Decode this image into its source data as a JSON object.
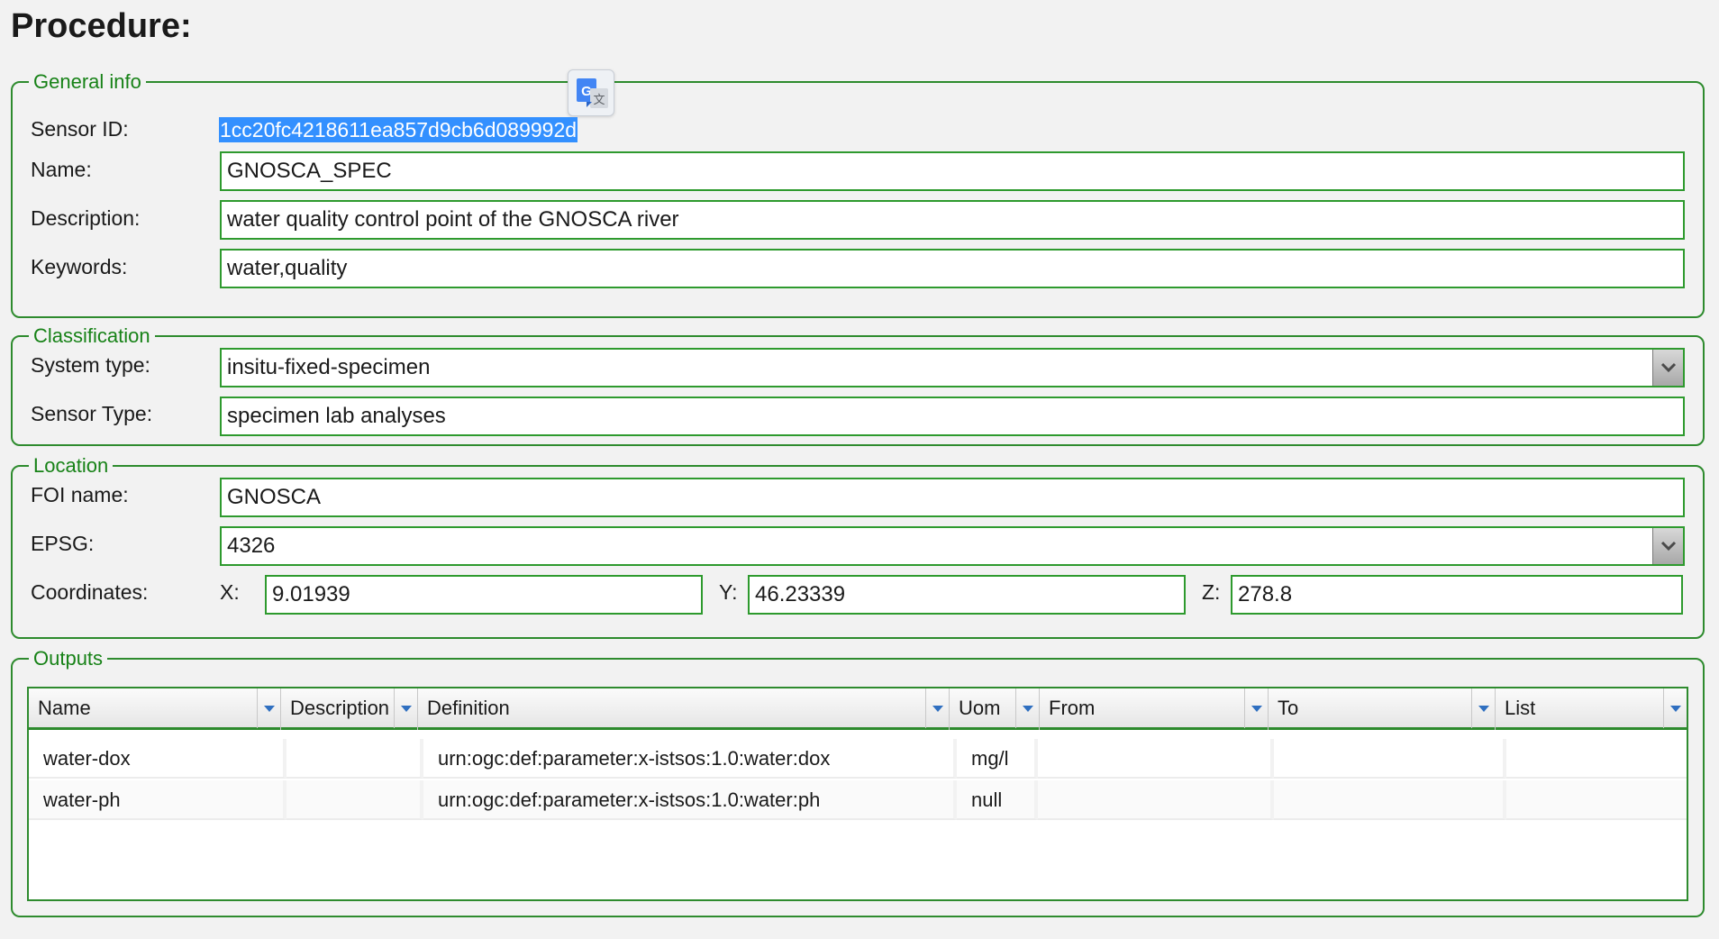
{
  "page": {
    "title": "Procedure:"
  },
  "general_info": {
    "legend": "General info",
    "sensor_id_label": "Sensor ID:",
    "sensor_id_value": "1cc20fc4218611ea857d9cb6d089992d",
    "name_label": "Name:",
    "name_value": "GNOSCA_SPEC",
    "description_label": "Description:",
    "description_value": "water quality control point of the GNOSCA river",
    "keywords_label": "Keywords:",
    "keywords_value": "water,quality"
  },
  "classification": {
    "legend": "Classification",
    "system_type_label": "System type:",
    "system_type_value": "insitu-fixed-specimen",
    "sensor_type_label": "Sensor Type:",
    "sensor_type_value": "specimen lab analyses"
  },
  "location": {
    "legend": "Location",
    "foi_label": "FOI name:",
    "foi_value": "GNOSCA",
    "epsg_label": "EPSG:",
    "epsg_value": "4326",
    "coordinates_label": "Coordinates:",
    "x_label": "X:",
    "x_value": "9.01939",
    "y_label": "Y:",
    "y_value": "46.23339",
    "z_label": "Z:",
    "z_value": "278.8"
  },
  "outputs": {
    "legend": "Outputs",
    "columns": [
      "Name",
      "Description",
      "Definition",
      "Uom",
      "From",
      "To",
      "List"
    ],
    "rows": [
      {
        "name": "water-dox",
        "description": "",
        "definition": "urn:ogc:def:parameter:x-istsos:1.0:water:dox",
        "uom": "mg/l",
        "from": "",
        "to": "",
        "list": ""
      },
      {
        "name": "water-ph",
        "description": "",
        "definition": "urn:ogc:def:parameter:x-istsos:1.0:water:ph",
        "uom": "null",
        "from": "",
        "to": "",
        "list": ""
      }
    ]
  },
  "icons": {
    "translate": "google-translate-icon",
    "dropdown": "chevron-down-icon"
  },
  "colors": {
    "accent_green": "#2e8b2e",
    "legend_green": "#178217",
    "selection_blue": "#3390ff"
  }
}
